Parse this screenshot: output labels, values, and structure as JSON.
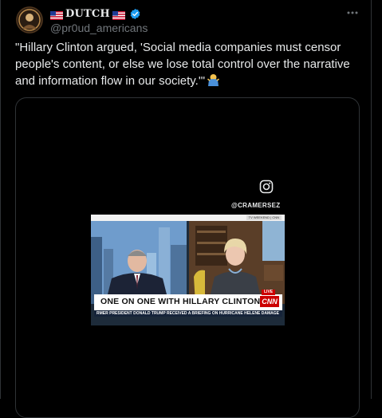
{
  "post": {
    "author": {
      "display_name": "DUTCH",
      "handle": "@pr0ud_americans",
      "verified": true,
      "badge_color": "#1d9bf0"
    },
    "more_icon": "more-horizontal-icon",
    "text": "\"Hillary Clinton argued, 'Social media companies must censor people's content, or else we lose total control over the narrative and information flow in our society.'\"",
    "text_emoji": "person-shrugging-emoji"
  },
  "media": {
    "overlay_handle": "@CRAMERSEZ",
    "overlay_icon": "instagram-icon",
    "video": {
      "top_strip_label": "TV WEEKEND | CNN",
      "headline": "ONE ON ONE WITH HILLARY CLINTON",
      "live_label": "LIVE",
      "network_logo": "CNN",
      "ticker": "RMER PRESIDENT DONALD TRUMP RECEIVED A BRIEFING ON HURRICANE HELENE DAMAGE"
    }
  },
  "colors": {
    "background": "#000000",
    "text": "#e7e9ea",
    "secondary_text": "#71767b",
    "border": "#2f3336",
    "cnn_red": "#cc0000"
  }
}
